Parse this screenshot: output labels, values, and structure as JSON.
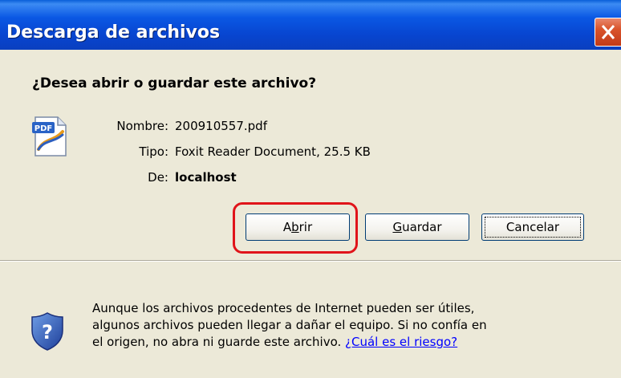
{
  "window": {
    "title": "Descarga de archivos",
    "close_icon": "close-icon"
  },
  "dialog": {
    "question": "¿Desea abrir o guardar este archivo?",
    "file_icon": "pdf-file-icon",
    "fields": {
      "name_label": "Nombre:",
      "name_value": "200910557.pdf",
      "type_label": "Tipo:",
      "type_value": "Foxit Reader Document, 25.5 KB",
      "from_label": "De:",
      "from_value": "localhost"
    },
    "buttons": {
      "open_pre": "A",
      "open_accel": "b",
      "open_post": "rir",
      "save_accel": "G",
      "save_post": "uardar",
      "cancel": "Cancelar"
    },
    "warning": {
      "icon": "security-shield-question-icon",
      "line1": "Aunque los archivos procedentes de Internet pueden ser útiles,",
      "line2": "algunos archivos pueden llegar a dañar el equipo. Si no confía en",
      "line3": "el origen, no abra ni guarde este archivo. ",
      "link": "¿Cuál es el riesgo?"
    }
  },
  "colors": {
    "titlebar": "#0a58e4",
    "dialog_bg": "#ece9d8",
    "highlight": "#e0141a",
    "link": "#0000ff"
  }
}
